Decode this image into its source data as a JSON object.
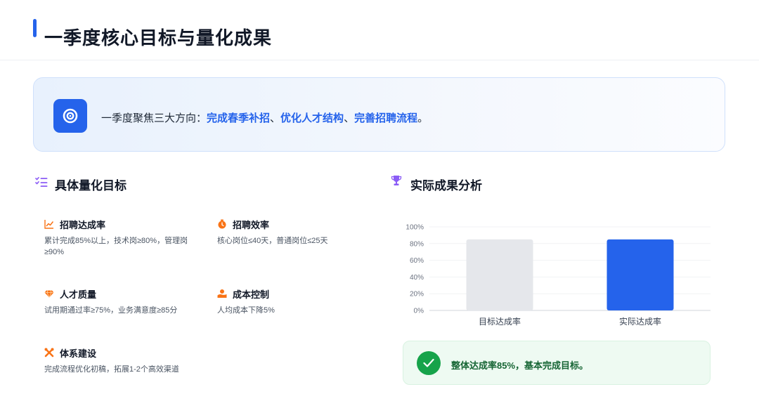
{
  "header": {
    "title": "一季度核心目标与量化成果"
  },
  "banner": {
    "icon": "target-icon",
    "prefix": "一季度聚焦三大方向：",
    "highlights": [
      "完成春季补招",
      "优化人才结构",
      "完善招聘流程"
    ],
    "separator": "、",
    "suffix": "。"
  },
  "goals_section": {
    "title": "具体量化目标",
    "icon": "list-check-icon",
    "items": [
      {
        "title": "招聘达成率",
        "icon": "trend-chart-icon",
        "desc": "累计完成85%以上，技术岗≥80%，管理岗≥90%"
      },
      {
        "title": "招聘效率",
        "icon": "stopwatch-icon",
        "desc": "核心岗位≤40天，普通岗位≤25天"
      },
      {
        "title": "人才质量",
        "icon": "gem-icon",
        "desc": "试用期通过率≥75%，业务满意度≥85分"
      },
      {
        "title": "成本控制",
        "icon": "coins-icon",
        "desc": "人均成本下降5%"
      },
      {
        "title": "体系建设",
        "icon": "tools-icon",
        "desc": "完成流程优化初稿，拓展1-2个高效渠道"
      }
    ]
  },
  "results_section": {
    "title": "实际成果分析",
    "icon": "trophy-icon"
  },
  "chart_data": {
    "type": "bar",
    "categories": [
      "目标达成率",
      "实际达成率"
    ],
    "values": [
      85,
      85
    ],
    "yticks": [
      "0%",
      "20%",
      "40%",
      "60%",
      "80%",
      "100%"
    ],
    "ylim": [
      0,
      100
    ],
    "colors": [
      "#e5e7eb",
      "#2563eb"
    ],
    "grid": true
  },
  "result_note": {
    "icon": "check-icon",
    "text": "整体达成率85%，基本完成目标。"
  },
  "colors": {
    "accent": "#2563eb",
    "success": "#16a34a",
    "orange": "#f97316",
    "purple": "#8b5cf6"
  }
}
